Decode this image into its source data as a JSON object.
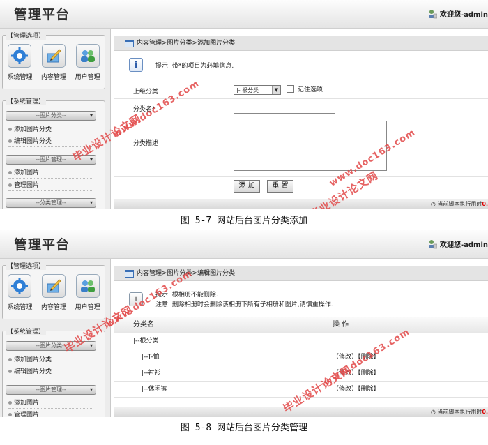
{
  "screens": [
    {
      "brand": "管理平台",
      "welcome": "欢迎您-admin",
      "quick_panel_title": "【管理选项】",
      "quick_icons": [
        "系统管理",
        "内容管理",
        "用户管理"
      ],
      "system_panel_title": "【系统管理】",
      "groups": [
        "--图片分类--",
        "--图片管理--",
        "--分类管理--"
      ],
      "items": [
        "添加图片分类",
        "编辑图片分类",
        "添加图片",
        "管理图片"
      ],
      "breadcrumb": "内容管理>图片分类>添加图片分类",
      "tip": "提示: 带*的项目为必填信息.",
      "form": {
        "parent_label": "上级分类",
        "parent_value": "|- 根分类",
        "remember_label": "记住选项",
        "name_label": "分类名*",
        "desc_label": "分类描述",
        "add_button": "添 加",
        "reset_button": "重 置"
      },
      "status": "当前脚本执行用时0."
    },
    {
      "brand": "管理平台",
      "welcome": "欢迎您-admin",
      "quick_panel_title": "【管理选项】",
      "quick_icons": [
        "系统管理",
        "内容管理",
        "用户管理"
      ],
      "system_panel_title": "【系统管理】",
      "groups": [
        "--图片分类--",
        "--图片管理--"
      ],
      "items": [
        "添加图片分类",
        "编辑图片分类",
        "添加图片",
        "管理图片"
      ],
      "breadcrumb": "内容管理>图片分类>编辑图片分类",
      "tip_line1": "提示: 根相册不能删除.",
      "tip_line2": "注意: 删除相册时会删除该相册下所有子相册和图片,请慎重操作.",
      "table": {
        "col_name": "分类名",
        "col_ops": "操 作",
        "rows": [
          {
            "name": "|--根分类",
            "ops": ""
          },
          {
            "name": "|--T-恤",
            "ops": "【修改】【删除】"
          },
          {
            "name": "|--衬衫",
            "ops": "【修改】【删除】"
          },
          {
            "name": "|--休闲裤",
            "ops": "【修改】【删除】"
          }
        ]
      },
      "status": "当前脚本执行用时0."
    }
  ],
  "captions": [
    "图 5-7  网站后台图片分类添加",
    "图 5-8  网站后台图片分类管理"
  ],
  "watermarks": [
    "毕业设计论文网",
    "www.doc163.com"
  ],
  "icons": {
    "user": "user-icon",
    "gear": "gear-icon",
    "edit": "edit-icon",
    "users": "users-icon",
    "info": "info-icon",
    "clock": "clock-icon"
  },
  "colors": {
    "watermark": "#e24848",
    "status_value": "#dd0000",
    "accent_blue": "#3a6fb5"
  }
}
